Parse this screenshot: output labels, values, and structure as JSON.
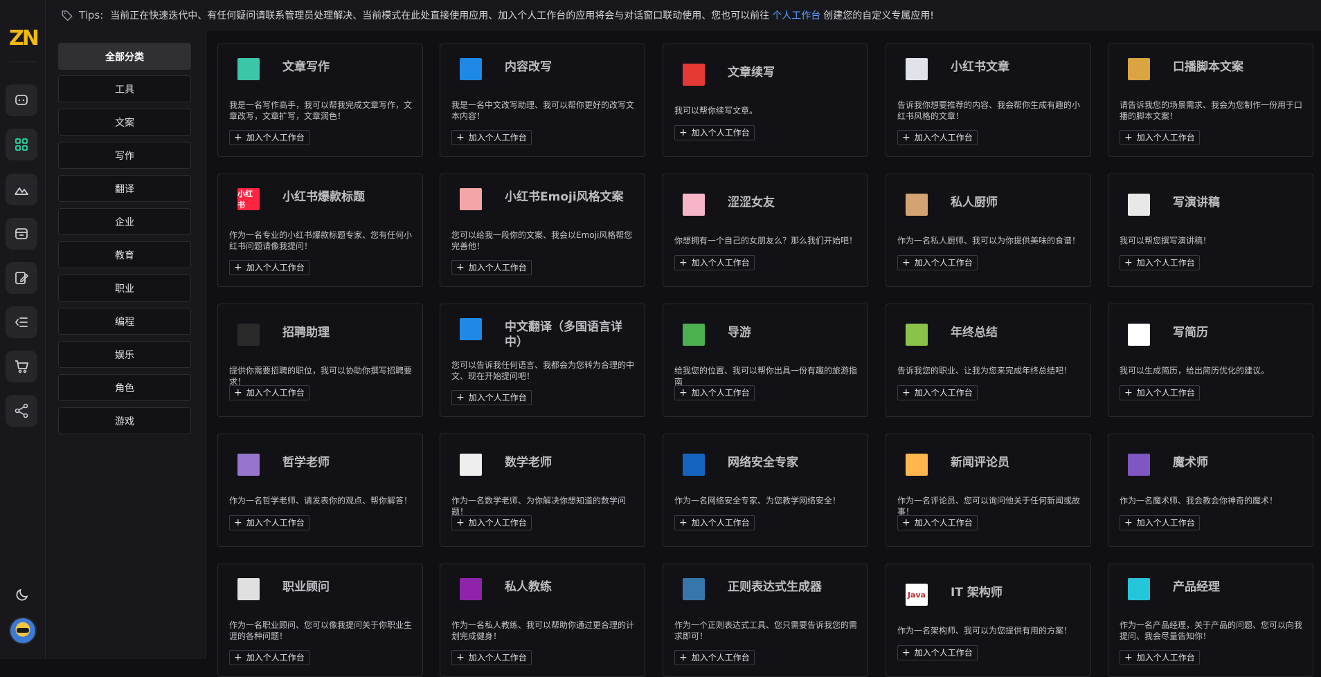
{
  "app": {
    "logo_text": "ZN"
  },
  "tips": {
    "label": "Tips:",
    "text_before": "当前正在快速迭代中、有任何疑问请联系管理员处理解决、当前模式在此处直接使用应用、加入个人工作台的应用将会与对话窗口联动使用、您也可以前往",
    "link": "个人工作台",
    "text_after": "创建您的自定义专属应用!"
  },
  "rail": {
    "items": [
      {
        "icon": "chat-icon"
      },
      {
        "icon": "apps-grid-icon",
        "active": true
      },
      {
        "icon": "image-mountain-icon"
      },
      {
        "icon": "box-icon"
      },
      {
        "icon": "edit-document-icon"
      },
      {
        "icon": "list-collapse-icon"
      },
      {
        "icon": "cart-icon"
      },
      {
        "icon": "share-icon"
      }
    ],
    "theme_icon": "moon-icon"
  },
  "categories": [
    "全部分类",
    "工具",
    "文案",
    "写作",
    "翻译",
    "企业",
    "教育",
    "职业",
    "编程",
    "娱乐",
    "角色",
    "游戏"
  ],
  "add_label": "加入个人工作台",
  "cards": [
    {
      "title": "文章写作",
      "desc": "我是一名写作高手，我可以帮我完成文章写作，文章改写，文章扩写，文章润色！",
      "icon": "writing-icon",
      "color": "#3cc6a8"
    },
    {
      "title": "内容改写",
      "desc": "我是一名中文改写助理、我可以帮你更好的改写文本内容！",
      "icon": "pen-icon",
      "color": "#1e88e5"
    },
    {
      "title": "文章续写",
      "desc": "我可以帮你续写文章。",
      "icon": "no-entry-icon",
      "color": "#e53935"
    },
    {
      "title": "小红书文章",
      "desc": "告诉我你想要推荐的内容、我会帮你生成有趣的小红书风格的文章！",
      "icon": "document-icon",
      "color": "#e0e4ea"
    },
    {
      "title": "口播脚本文案",
      "desc": "请告诉我您的场景需求、我会为您制作一份用于口播的脚本文案！",
      "icon": "microphone-icon",
      "color": "#d9a441"
    },
    {
      "title": "小红书爆款标题",
      "desc": "作为一名专业的小红书爆款标题专家、您有任何小红书问题请像我提问！",
      "icon": "xiaohongshu-icon",
      "color": "#ff2442",
      "icon_text": "小红书"
    },
    {
      "title": "小红书Emoji风格文案",
      "desc": "您可以给我一段你的文案、我会以Emoji风格帮您完善他！",
      "icon": "emoji-icon",
      "color": "#f4a6a6"
    },
    {
      "title": "涩涩女友",
      "desc": "你想拥有一个自己的女朋友么？那么我们开始吧！",
      "icon": "girl-avatar-icon",
      "color": "#f7b6c8"
    },
    {
      "title": "私人厨师",
      "desc": "作为一名私人厨师、我可以为你提供美味的食谱！",
      "icon": "chef-icon",
      "color": "#d4a373"
    },
    {
      "title": "写演讲稿",
      "desc": "我可以帮您撰写演讲稿！",
      "icon": "speaker-icon",
      "color": "#e8e8e8"
    },
    {
      "title": "招聘助理",
      "desc": "提供你需要招聘的职位，我可以协助你撰写招聘要求！",
      "icon": "recruiter-icon",
      "color": "#2a2a2a"
    },
    {
      "title": "中文翻译（多国语言详中）",
      "desc": "您可以告诉我任何语言、我都会为您转为合理的中文、现在开始提问吧！",
      "icon": "translate-icon",
      "color": "#1e88e5"
    },
    {
      "title": "导游",
      "desc": "给我您的位置、我可以帮你出具一份有趣的旅游指南",
      "icon": "globe-icon",
      "color": "#4caf50"
    },
    {
      "title": "年终总结",
      "desc": "告诉我您的职业、让我为您来完成年终总结吧！",
      "icon": "report-icon",
      "color": "#8bc34a"
    },
    {
      "title": "写简历",
      "desc": "我可以生成简历，给出简历优化的建议。",
      "icon": "resume-icon",
      "color": "#ffffff"
    },
    {
      "title": "哲学老师",
      "desc": "作为一名哲学老师、请发表你的观点、帮你解答！",
      "icon": "philosopher-icon",
      "color": "#9575cd"
    },
    {
      "title": "数学老师",
      "desc": "作为一名数学老师、为你解决你想知道的数学问题！",
      "icon": "math-teacher-icon",
      "color": "#eeeeee"
    },
    {
      "title": "网络安全专家",
      "desc": "作为一名网络安全专家、为您教学网络安全！",
      "icon": "security-icon",
      "color": "#1565c0"
    },
    {
      "title": "新闻评论员",
      "desc": "作为一名评论员、您可以询问他关于任何新闻或故事！",
      "icon": "commentator-icon",
      "color": "#ffb74d"
    },
    {
      "title": "魔术师",
      "desc": "作为一名魔术师、我会教会你神奇的魔术！",
      "icon": "magician-icon",
      "color": "#7e57c2"
    },
    {
      "title": "职业顾问",
      "desc": "作为一名职业顾问、您可以像我提问关于你职业生涯的各种问题！",
      "icon": "consultant-icon",
      "color": "#e0e0e0"
    },
    {
      "title": "私人教练",
      "desc": "作为一名私人教练、我可以帮助你通过更合理的计划完成健身！",
      "icon": "trainer-icon",
      "color": "#8e24aa"
    },
    {
      "title": "正则表达式生成器",
      "desc": "作为一个正则表达式工具、您只需要告诉我您的需求即可！",
      "icon": "python-icon",
      "color": "#3776ab"
    },
    {
      "title": "IT 架构师",
      "desc": "作为一名架构师、我可以为您提供有用的方案！",
      "icon": "java-icon",
      "color": "#ffffff",
      "icon_text": "Java"
    },
    {
      "title": "产品经理",
      "desc": "作为一名产品经理，关于产品的问题、您可以向我提问、我会尽量告知你！",
      "icon": "product-icon",
      "color": "#26c6da"
    }
  ]
}
